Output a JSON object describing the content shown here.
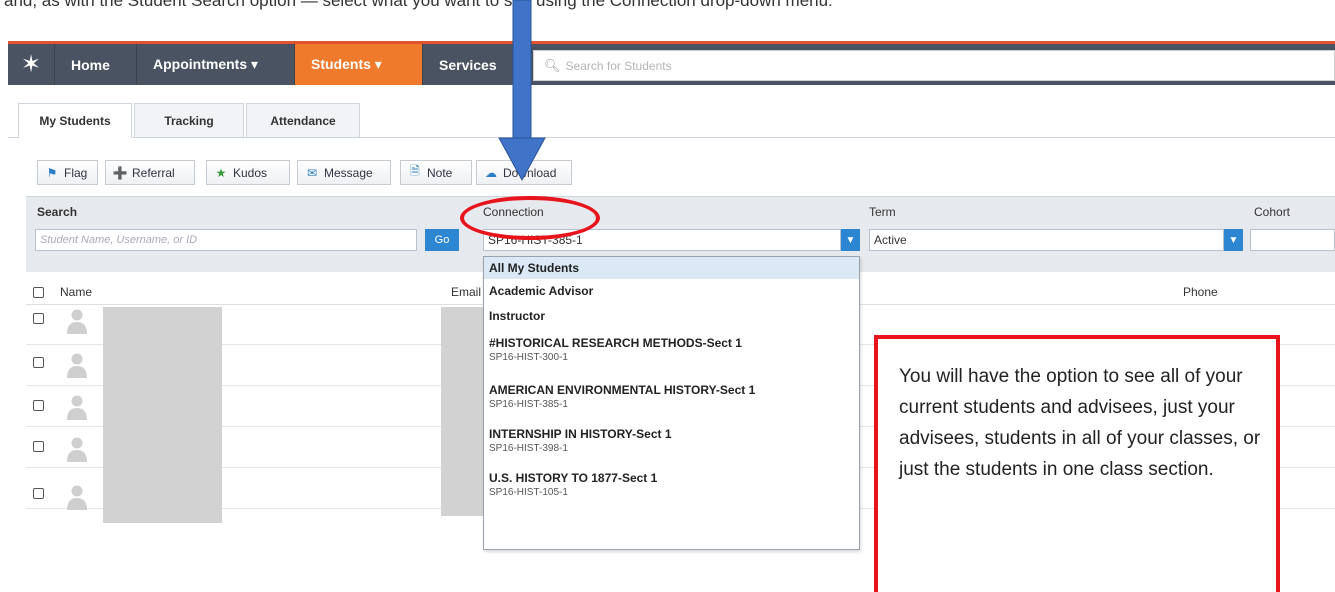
{
  "caption": "and, as with the Student Search option — select what you want to see using the Connection drop-down menu:",
  "nav": {
    "items": [
      {
        "label": "Home",
        "active": false
      },
      {
        "label": "Appointments  ▾",
        "active": false
      },
      {
        "label": "Students  ▾",
        "active": true
      },
      {
        "label": "Services",
        "active": false
      }
    ],
    "search_placeholder": "Search for Students"
  },
  "tabs": [
    "My Students",
    "Tracking",
    "Attendance"
  ],
  "actions": [
    "Flag",
    "Referral",
    "Kudos",
    "Message",
    "Note",
    "Download"
  ],
  "filters": {
    "search_label": "Search",
    "search_placeholder": "Student Name, Username, or ID",
    "go_label": "Go",
    "connection_label": "Connection",
    "connection_value": "SP16-HIST-385-1",
    "term_label": "Term",
    "term_value": "Active",
    "cohort_label": "Cohort"
  },
  "table": {
    "col_name": "Name",
    "col_email": "Email",
    "col_phone": "Phone"
  },
  "dropdown": {
    "options": [
      {
        "label": "All My Students",
        "sub": ""
      },
      {
        "label": "Academic Advisor",
        "sub": ""
      },
      {
        "label": "Instructor",
        "sub": ""
      },
      {
        "label": "#HISTORICAL RESEARCH METHODS-Sect 1",
        "sub": "SP16-HIST-300-1"
      },
      {
        "label": "AMERICAN ENVIRONMENTAL HISTORY-Sect 1",
        "sub": "SP16-HIST-385-1"
      },
      {
        "label": "INTERNSHIP IN HISTORY-Sect 1",
        "sub": "SP16-HIST-398-1"
      },
      {
        "label": "U.S. HISTORY TO 1877-Sect 1",
        "sub": "SP16-HIST-105-1"
      }
    ]
  },
  "annotation": "You will have the option to see all of your current students and advisees, just your advisees, students in all of your classes, or just the students in one class section.",
  "colors": {
    "nav_bg": "#4a5361",
    "accent": "#ef7a2c",
    "highlight": "#e8141c",
    "arrow": "#3f74c8"
  }
}
